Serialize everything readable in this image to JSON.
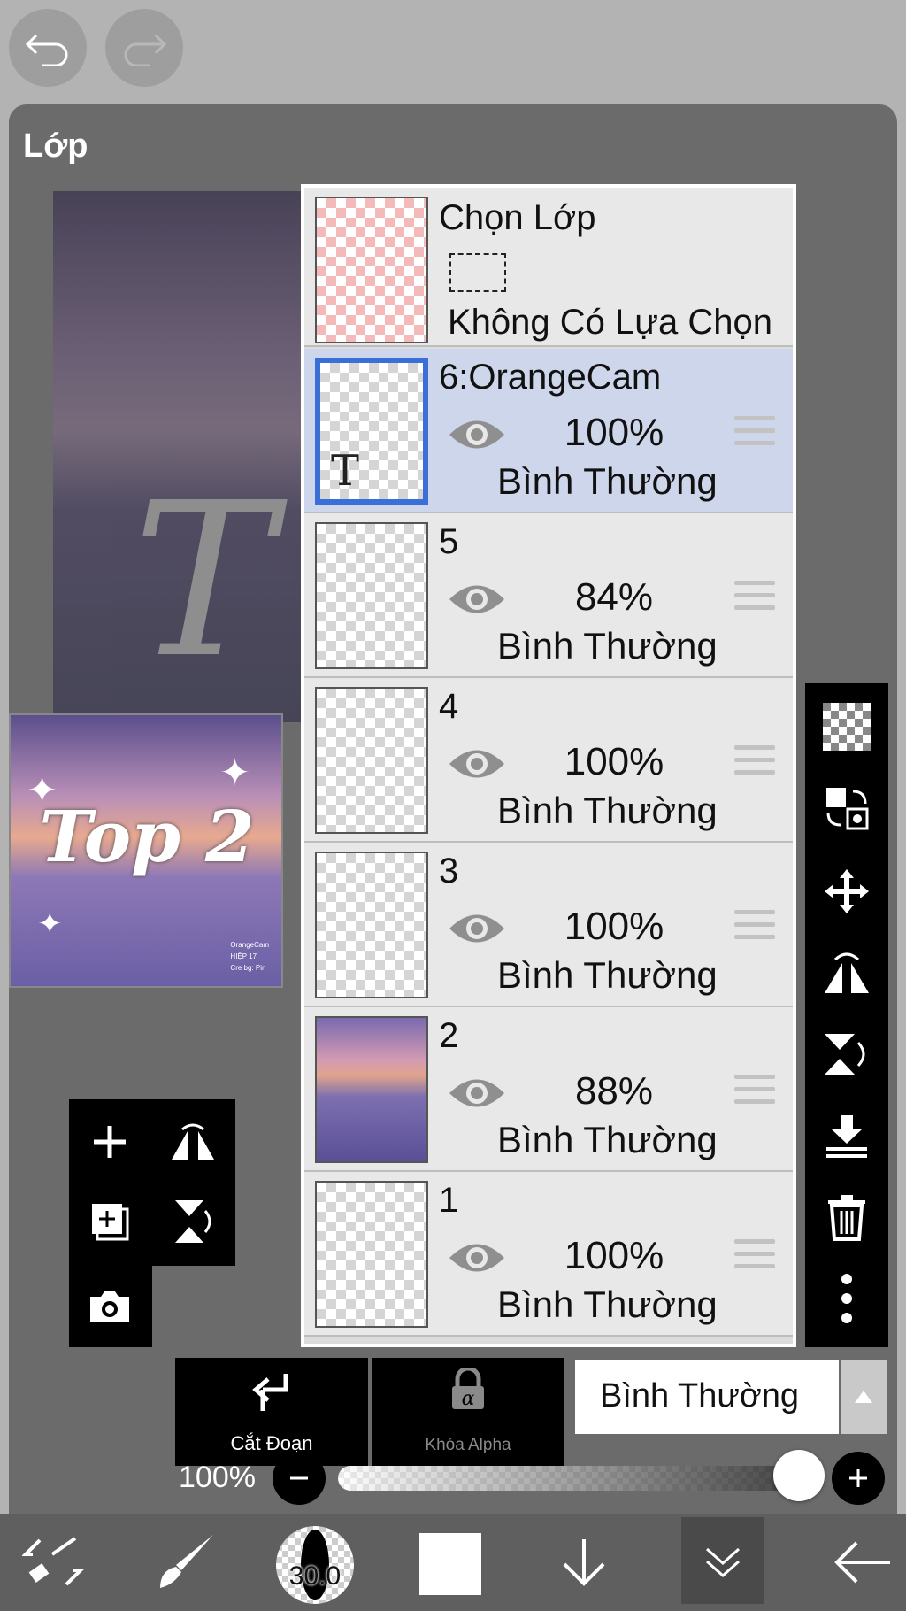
{
  "panel": {
    "title": "Lớp"
  },
  "preview": {
    "artwork_title": "Top 2",
    "credits": [
      "OrangeCam",
      "HIỆP 17",
      "Cre bg: Pin"
    ]
  },
  "selection_layer": {
    "title": "Chọn Lớp",
    "status": "Không Có Lựa Chọn"
  },
  "layers": [
    {
      "name": "6:OrangeCam",
      "opacity": "100%",
      "blend": "Bình Thường",
      "selected": true,
      "type": "text"
    },
    {
      "name": "5",
      "opacity": "84%",
      "blend": "Bình Thường",
      "selected": false,
      "type": "raster"
    },
    {
      "name": "4",
      "opacity": "100%",
      "blend": "Bình Thường",
      "selected": false,
      "type": "raster"
    },
    {
      "name": "3",
      "opacity": "100%",
      "blend": "Bình Thường",
      "selected": false,
      "type": "raster"
    },
    {
      "name": "2",
      "opacity": "88%",
      "blend": "Bình Thường",
      "selected": false,
      "type": "photo"
    },
    {
      "name": "1",
      "opacity": "100%",
      "blend": "Bình Thường",
      "selected": false,
      "type": "raster"
    }
  ],
  "controls": {
    "clip_label": "Cắt Đoạn",
    "alpha_lock_label": "Khóa Alpha",
    "blend_mode": "Bình Thường",
    "layer_opacity": "100%",
    "layer_opacity_value": 1.0
  },
  "toolbar": {
    "brush_size": "30.0",
    "primary_color": "#ffffff"
  },
  "colors": {
    "selection_highlight": "#cdd6ea",
    "selection_border": "#3a6fd8",
    "panel_bg": "#6b6b6b"
  },
  "icons": {
    "undo": "undo-icon",
    "redo": "redo-icon",
    "eye": "eye-icon",
    "drag_handle": "drag-handle-icon"
  }
}
